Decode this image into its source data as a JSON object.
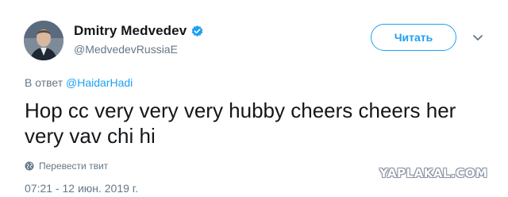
{
  "tweet": {
    "display_name": "Dmitry Medvedev",
    "handle": "@MedvedevRussiaE",
    "follow_label": "Читать",
    "reply_prefix": "В ответ",
    "reply_to": "@HaidarHadi",
    "text": "Hop cc very very very hubby cheers cheers her very vav chi hi",
    "translate_label": "Перевести твит",
    "timestamp": "07:21 - 12 июн. 2019 г."
  },
  "watermark": "YAPLAKAL.COM",
  "colors": {
    "accent": "#1da1f2",
    "secondary_text": "#657786",
    "primary_text": "#14171a"
  },
  "icons": {
    "verified": "verified-badge-icon",
    "caret": "chevron-down-icon",
    "translate": "globe-icon"
  }
}
